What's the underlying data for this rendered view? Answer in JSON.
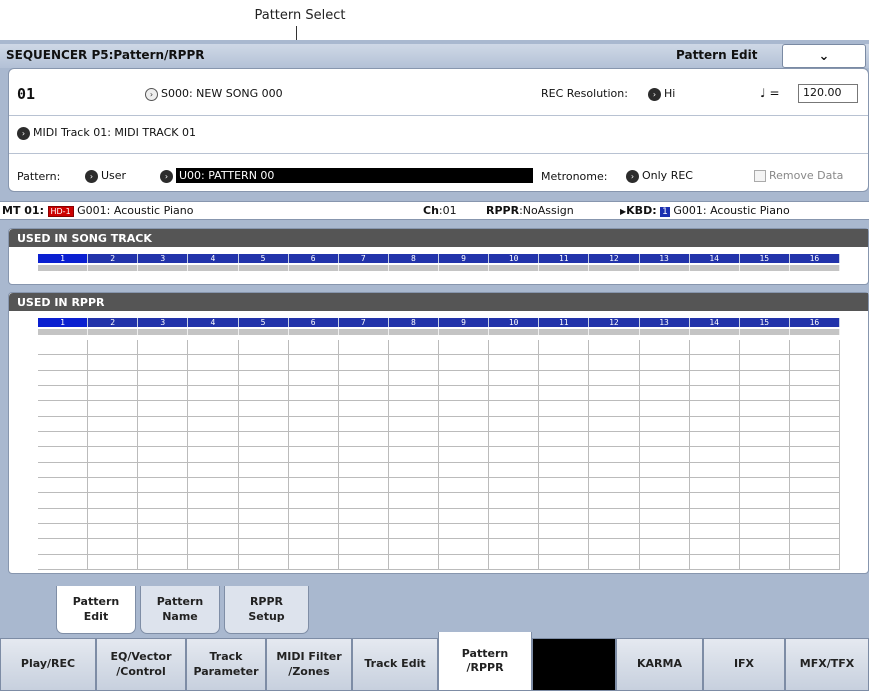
{
  "callout": {
    "label": "Pattern Select"
  },
  "header": {
    "title": "SEQUENCER P5:Pattern/RPPR",
    "page": "Pattern Edit",
    "menu_icon": "chevron-down-icon"
  },
  "song": {
    "number": "01",
    "name": "S000: NEW SONG 000",
    "rec_res_label": "REC Resolution:",
    "rec_res_value": "Hi",
    "tempo_symbol": "♩ =",
    "tempo": "120.00"
  },
  "track": {
    "label": "MIDI Track 01: MIDI TRACK 01"
  },
  "pattern": {
    "label": "Pattern:",
    "bank": "User",
    "name": "U00: PATTERN 00",
    "metronome_label": "Metronome:",
    "metronome_value": "Only REC",
    "remove_label": "Remove Data"
  },
  "status": {
    "mt": "MT 01:",
    "hd": "HD-1",
    "program": "G001: Acoustic Piano",
    "ch_label": "Ch",
    "ch": ":01",
    "rppr_label": "RPPR",
    "rppr": ":NoAssign",
    "kbd_label": "KBD:",
    "kbd_num": "1",
    "kbd_prog": "G001: Acoustic Piano"
  },
  "song_track": {
    "heading": "USED IN SONG TRACK",
    "tracks": [
      "1",
      "2",
      "3",
      "4",
      "5",
      "6",
      "7",
      "8",
      "9",
      "10",
      "11",
      "12",
      "13",
      "14",
      "15",
      "16"
    ]
  },
  "rppr": {
    "heading": "USED IN RPPR",
    "tracks": [
      "1",
      "2",
      "3",
      "4",
      "5",
      "6",
      "7",
      "8",
      "9",
      "10",
      "11",
      "12",
      "13",
      "14",
      "15",
      "16"
    ]
  },
  "subtabs": [
    {
      "l1": "Pattern",
      "l2": "Edit"
    },
    {
      "l1": "Pattern",
      "l2": "Name"
    },
    {
      "l1": "RPPR",
      "l2": "Setup"
    }
  ],
  "bottomtabs": [
    {
      "l1": "Play/REC",
      "l2": ""
    },
    {
      "l1": "EQ/Vector",
      "l2": "/Control"
    },
    {
      "l1": "Track",
      "l2": "Parameter"
    },
    {
      "l1": "MIDI Filter",
      "l2": "/Zones"
    },
    {
      "l1": "Track Edit",
      "l2": ""
    },
    {
      "l1": "Pattern",
      "l2": "/RPPR"
    },
    {
      "l1": "",
      "l2": ""
    },
    {
      "l1": "KARMA",
      "l2": ""
    },
    {
      "l1": "IFX",
      "l2": ""
    },
    {
      "l1": "MFX/TFX",
      "l2": ""
    }
  ],
  "colors": {
    "track_selected": "#0a1fd0",
    "track": "#2233aa",
    "screen_bg": "#a9b8cf"
  }
}
